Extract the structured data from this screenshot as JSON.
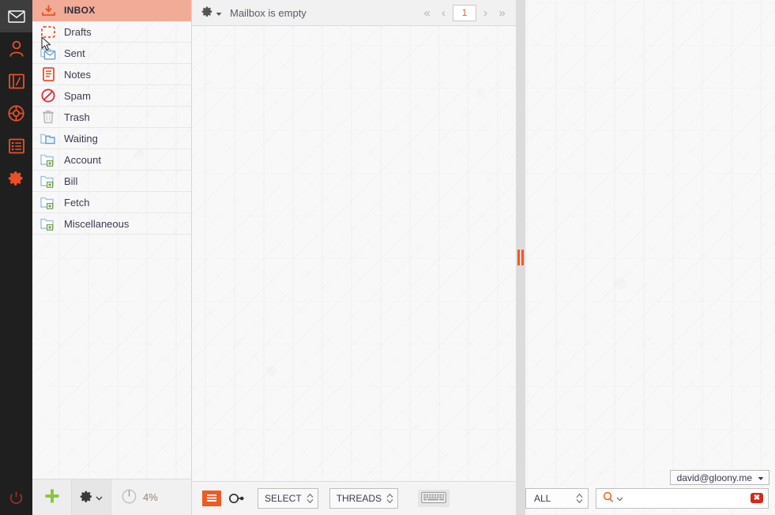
{
  "rail": {
    "items": [
      {
        "name": "mail",
        "icon": "envelope-icon",
        "active": true
      },
      {
        "name": "contacts",
        "icon": "person-icon",
        "active": false
      },
      {
        "name": "notes",
        "icon": "notebook-icon",
        "active": false
      },
      {
        "name": "support",
        "icon": "lifebuoy-icon",
        "active": false
      },
      {
        "name": "tasks",
        "icon": "task-list-icon",
        "active": false
      },
      {
        "name": "settings",
        "icon": "gear-icon",
        "active": false
      }
    ],
    "power": {
      "label": "Quit",
      "icon": "power-icon"
    }
  },
  "folders": {
    "items": [
      {
        "label": "INBOX",
        "icon": "inbox-icon",
        "selected": true
      },
      {
        "label": "Drafts",
        "icon": "drafts-icon",
        "selected": false
      },
      {
        "label": "Sent",
        "icon": "sent-icon",
        "selected": false
      },
      {
        "label": "Notes",
        "icon": "notes-icon",
        "selected": false
      },
      {
        "label": "Spam",
        "icon": "spam-icon",
        "selected": false
      },
      {
        "label": "Trash",
        "icon": "trash-icon",
        "selected": false
      },
      {
        "label": "Waiting",
        "icon": "folder-multi-icon",
        "selected": false
      },
      {
        "label": "Account",
        "icon": "folder-plus-icon",
        "selected": false
      },
      {
        "label": "Bill",
        "icon": "folder-plus-icon",
        "selected": false
      },
      {
        "label": "Fetch",
        "icon": "folder-plus-icon",
        "selected": false
      },
      {
        "label": "Miscellaneous",
        "icon": "folder-plus-icon",
        "selected": false
      }
    ],
    "footer": {
      "add_label": "+",
      "add_icon": "plus-icon",
      "settings_icon": "gear-icon",
      "settings_caret": "chevron-down-icon",
      "quota_icon": "quota-pie-icon",
      "quota_value": "4%"
    }
  },
  "messages": {
    "toolbar": {
      "gear_icon": "gear-icon",
      "gear_caret": "caret-down-icon",
      "status": "Mailbox is empty",
      "pager": {
        "first_icon": "double-chevron-left-icon",
        "prev_icon": "chevron-left-icon",
        "page_value": "1",
        "next_icon": "chevron-right-icon",
        "last_icon": "double-chevron-right-icon"
      }
    },
    "footer": {
      "list_view_icon": "list-view-icon",
      "thread_link_icon": "link-icon",
      "select_label": "SELECT",
      "select_caret": "spinner-arrows-icon",
      "threads_label": "THREADS",
      "threads_caret": "spinner-arrows-icon",
      "keyboard_icon": "keyboard-icon"
    }
  },
  "splitter": {
    "grip_icon": "drag-grip-icon"
  },
  "reading_pane": {
    "account_label": "david@gloony.me",
    "account_caret": "caret-down-icon"
  },
  "search": {
    "filter_label": "ALL",
    "filter_caret": "spinner-arrows-icon",
    "search_icon": "magnifier-icon",
    "search_caret": "chevron-down-icon",
    "value": "",
    "placeholder": "",
    "clear_icon": "clear-x-icon"
  },
  "colors": {
    "accent": "#ef5a23",
    "selected_row": "#f2ab96",
    "rail_bg": "#1f1f1f",
    "rail_active": "#3d3d3d",
    "clear_red": "#d9261c",
    "add_green": "#8cc63e",
    "folder_blue": "#9ec2e0"
  }
}
